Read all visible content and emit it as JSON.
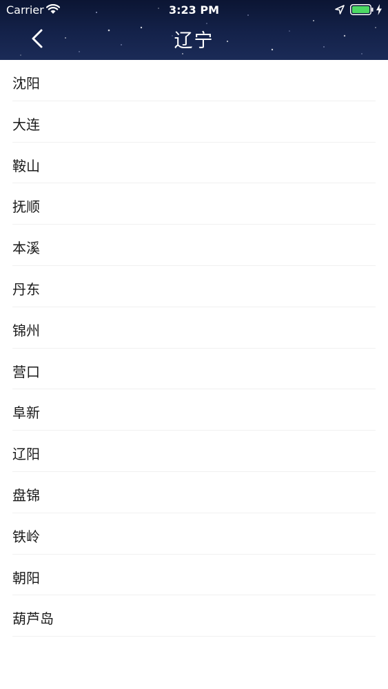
{
  "status_bar": {
    "carrier": "Carrier",
    "time": "3:23 PM",
    "icons": [
      "wifi-icon",
      "location-arrow-icon",
      "battery-icon",
      "charging-bolt-icon"
    ],
    "battery_color": "#4cd964"
  },
  "nav": {
    "title": "辽宁",
    "back_icon": "chevron-left-icon",
    "background": "#0b1533"
  },
  "cities": [
    {
      "label": "沈阳"
    },
    {
      "label": "大连"
    },
    {
      "label": "鞍山"
    },
    {
      "label": "抚顺"
    },
    {
      "label": "本溪"
    },
    {
      "label": "丹东"
    },
    {
      "label": "锦州"
    },
    {
      "label": "营口"
    },
    {
      "label": "阜新"
    },
    {
      "label": "辽阳"
    },
    {
      "label": "盘锦"
    },
    {
      "label": "铁岭"
    },
    {
      "label": "朝阳"
    },
    {
      "label": "葫芦岛"
    }
  ]
}
